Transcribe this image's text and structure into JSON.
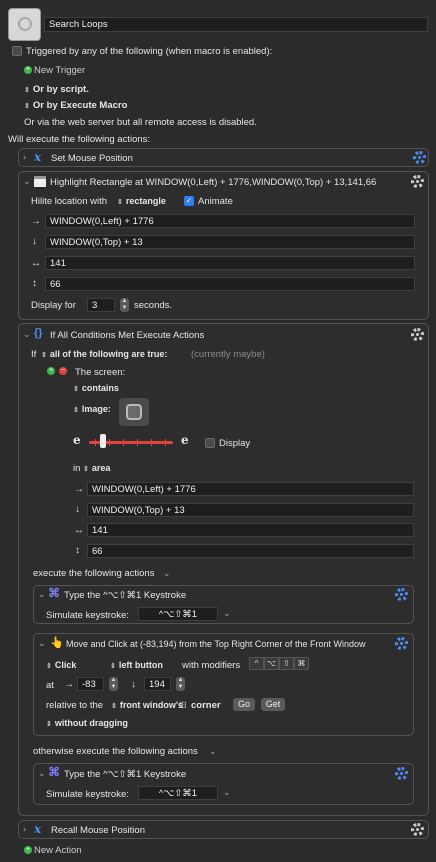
{
  "macro": {
    "name": "Search Loops",
    "triggered_label": "Triggered by any of the following (when macro is enabled):",
    "new_trigger": "New Trigger",
    "or_by_script": "Or by script.",
    "or_by_execute": "Or by Execute Macro",
    "web_server_note": "Or via the web server but all remote access is disabled.",
    "will_execute": "Will execute the following actions:"
  },
  "actions": {
    "set_mouse": "Set Mouse Position",
    "highlight": {
      "title": "Highlight Rectangle at WINDOW(0,Left) + 1776,WINDOW(0,Top) + 13,141,66",
      "hilite_label": "Hilite location with",
      "hilite_value": "rectangle",
      "animate": "Animate",
      "left": "WINDOW(0,Left) + 1776",
      "top": "WINDOW(0,Top) + 13",
      "width": "141",
      "height": "66",
      "display_for": "Display for",
      "seconds_value": "3",
      "seconds": "seconds."
    },
    "ifall": {
      "title": "If All Conditions Met Execute Actions",
      "if": "If",
      "all_following": "all of the following are true:",
      "currently": "(currently maybe)",
      "screen": "The screen:",
      "contains": "contains",
      "image": "Image:",
      "display": "Display",
      "in": "in",
      "area": "area",
      "left": "WINDOW(0,Left) + 1776",
      "top": "WINDOW(0,Top) + 13",
      "width": "141",
      "height": "66",
      "execute_following": "execute the following actions",
      "otherwise": "otherwise execute the following actions"
    },
    "type1": {
      "title": "Type the ^⌥⇧⌘1 Keystroke",
      "simulate": "Simulate keystroke:",
      "keystroke": "^⌥⇧⌘1"
    },
    "move": {
      "title": "Move and Click at (-83,194) from the Top Right Corner of the Front Window",
      "click": "Click",
      "left_button": "left button",
      "with_modifiers": "with modifiers",
      "mods": [
        "^",
        "⌥",
        "⇧",
        "⌘"
      ],
      "at": "at",
      "x": "-83",
      "y": "194",
      "relative": "relative to the",
      "front_window": "front window's",
      "corner": "corner",
      "go": "Go",
      "get": "Get",
      "without_dragging": "without dragging"
    },
    "type2": {
      "title": "Type the ^⌥⇧⌘1 Keystroke",
      "simulate": "Simulate keystroke:",
      "keystroke": "^⌥⇧⌘1"
    },
    "recall": "Recall Mouse Position",
    "new_action": "New Action"
  }
}
